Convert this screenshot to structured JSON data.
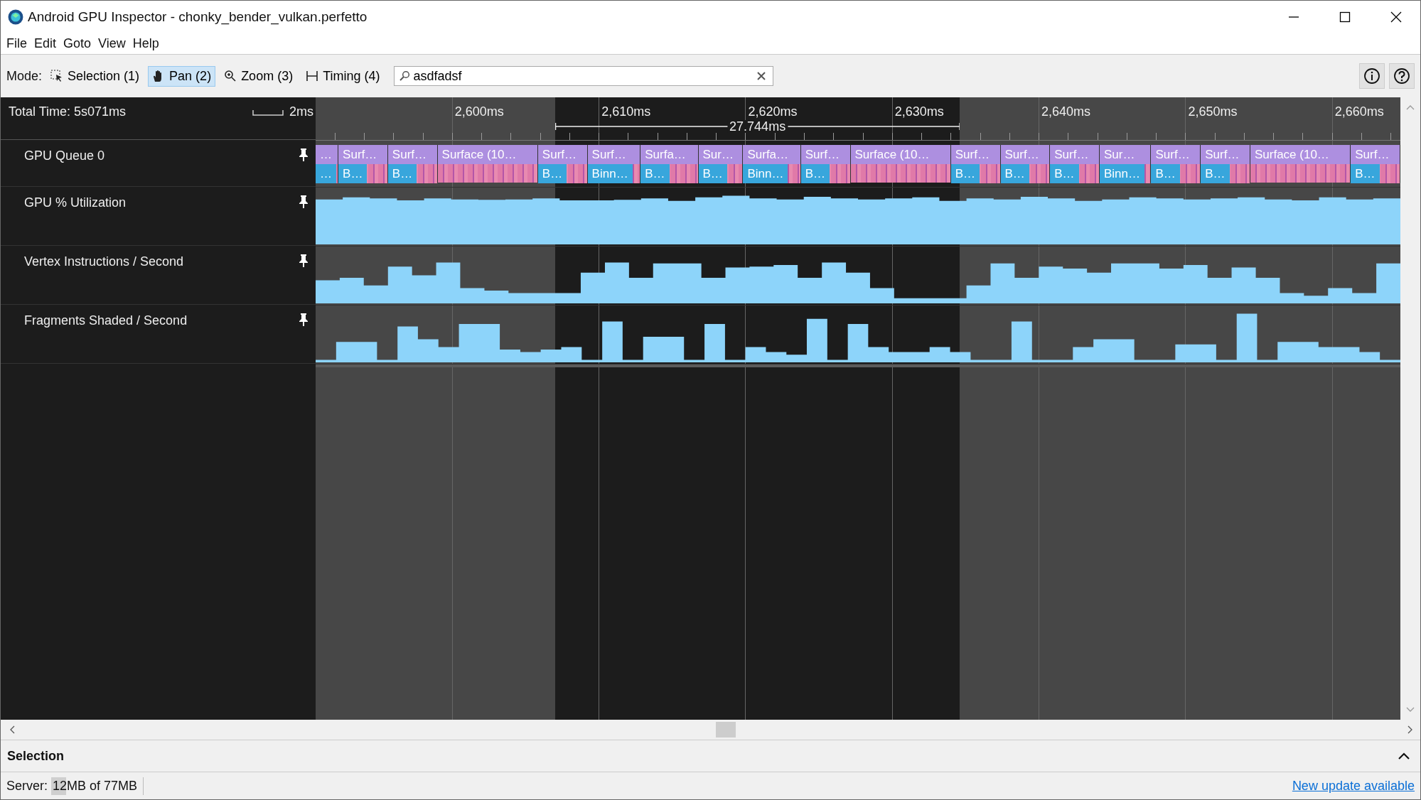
{
  "window": {
    "title": "Android GPU Inspector - chonky_bender_vulkan.perfetto"
  },
  "menu": [
    "File",
    "Edit",
    "Goto",
    "View",
    "Help"
  ],
  "toolbar": {
    "mode_label": "Mode:",
    "modes": [
      {
        "kind": "selection",
        "label": "Selection (1)",
        "selected": false
      },
      {
        "kind": "pan",
        "label": "Pan (2)",
        "selected": true
      },
      {
        "kind": "zoom",
        "label": "Zoom (3)",
        "selected": false
      },
      {
        "kind": "timing",
        "label": "Timing (4)",
        "selected": false
      }
    ],
    "search": {
      "value": "asdfadsf"
    }
  },
  "timeline": {
    "total_time": "Total Time: 5s071ms",
    "scale": "2ms",
    "ticks": [
      "2,600ms",
      "2,610ms",
      "2,620ms",
      "2,630ms",
      "2,640ms",
      "2,650ms",
      "2,660ms"
    ],
    "selection_duration": "27.744ms",
    "tracks": [
      {
        "kind": "queue",
        "name": "GPU Queue 0",
        "slices": [
          {
            "label": "…",
            "sub": "…"
          },
          {
            "label": "Surf…",
            "sub": "B…"
          },
          {
            "label": "Surf…",
            "sub": "B…"
          },
          {
            "label": "Surface (10…"
          },
          {
            "label": "Surf…",
            "sub": "B…"
          },
          {
            "label": "Surf…",
            "sub": "Binn…"
          },
          {
            "label": "Surfa…",
            "sub": "B…"
          },
          {
            "label": "Sur…",
            "sub": "B…"
          },
          {
            "label": "Surfa…",
            "sub": "Binn…"
          },
          {
            "label": "Surf…",
            "sub": "B…"
          },
          {
            "label": "Surface (10…"
          },
          {
            "label": "Surf…",
            "sub": "B…"
          },
          {
            "label": "Surf…",
            "sub": "B…"
          },
          {
            "label": "Surf…",
            "sub": "B…"
          },
          {
            "label": "Sur…",
            "sub": "Binn…"
          },
          {
            "label": "Surf…",
            "sub": "B…"
          },
          {
            "label": "Surf…",
            "sub": "B…"
          },
          {
            "label": "Surface (10…"
          },
          {
            "label": "Surf…",
            "sub": "B…"
          }
        ]
      },
      {
        "kind": "graph",
        "name": "GPU % Utilization"
      },
      {
        "kind": "graph",
        "name": "Vertex Instructions / Second"
      },
      {
        "kind": "graph",
        "name": "Fragments Shaded / Second"
      }
    ]
  },
  "bottom_panel": {
    "title": "Selection"
  },
  "status_bar": {
    "server_label": "Server:",
    "memory": "12MB of 77MB",
    "level": 0.16,
    "link": "New update available"
  }
}
